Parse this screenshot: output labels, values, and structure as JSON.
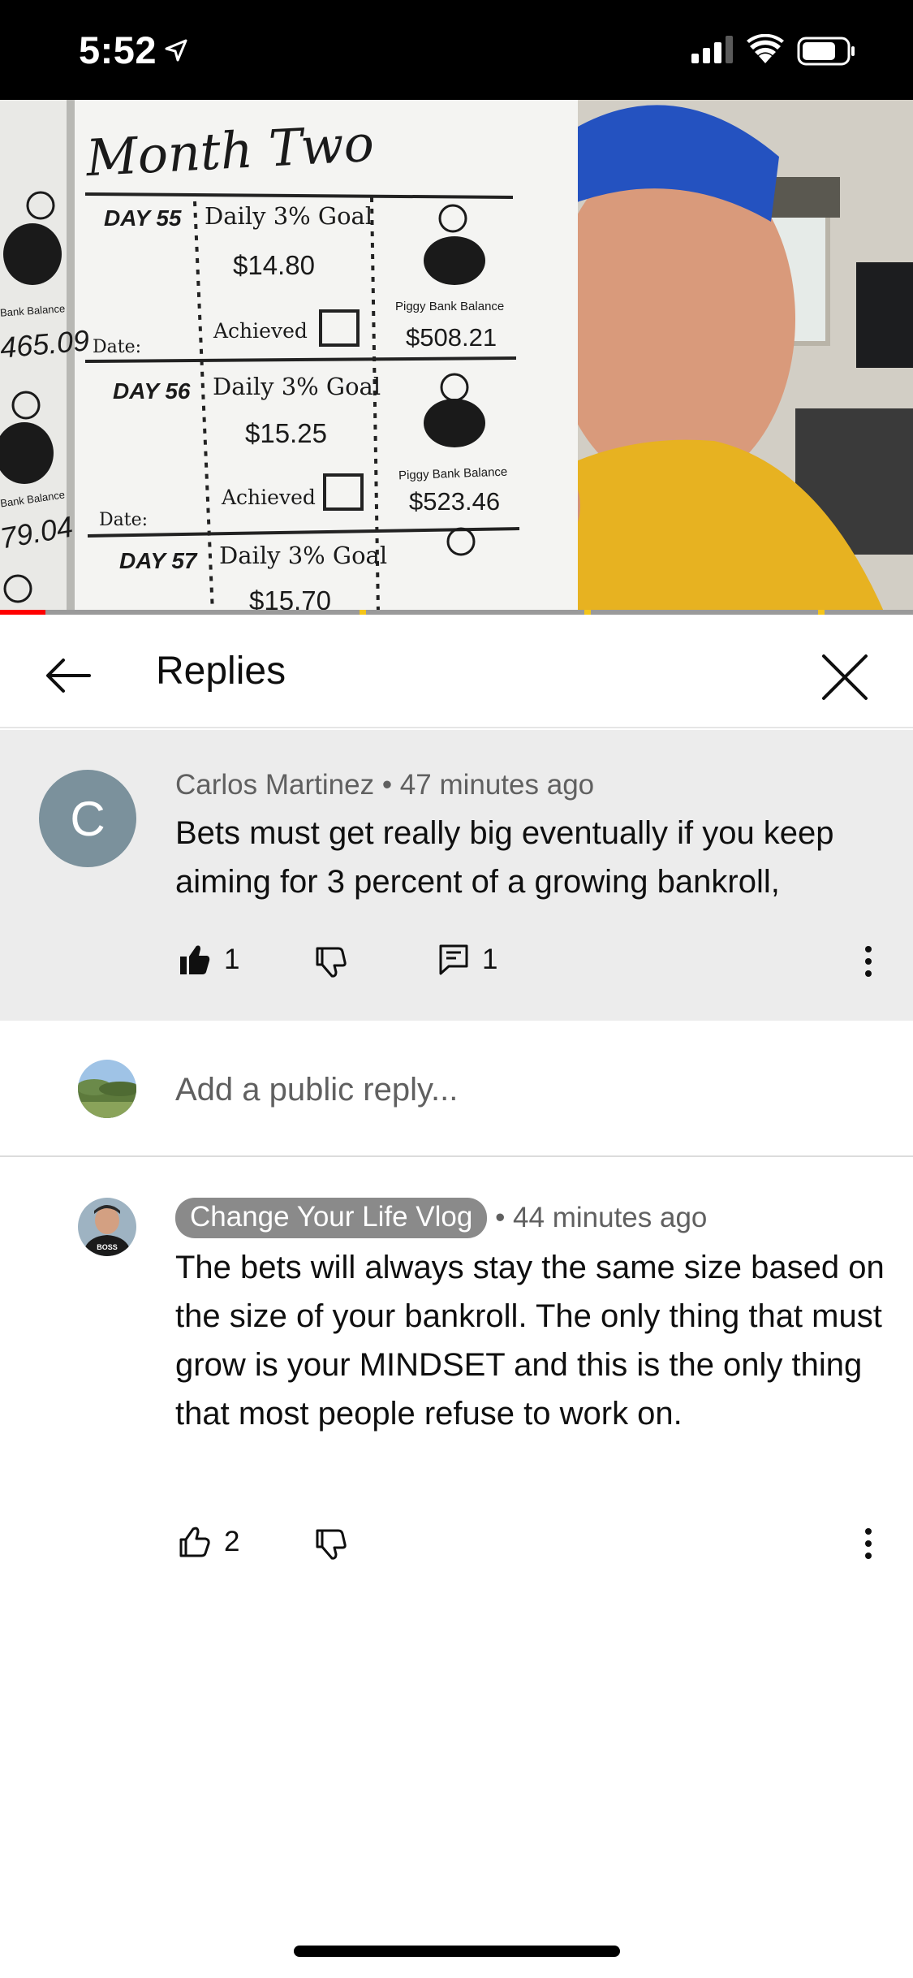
{
  "status_bar": {
    "time": "5:52"
  },
  "video": {
    "page_title": "Month Two",
    "days": [
      {
        "day": "DAY 55",
        "goal_label": "Daily 3% Goal",
        "goal": "$14.80",
        "achieved_label": "Achieved",
        "piggy_label": "Piggy Bank Balance",
        "balance": "$508.21"
      },
      {
        "day": "DAY 56",
        "goal_label": "Daily 3% Goal",
        "goal": "$15.25",
        "achieved_label": "Achieved",
        "piggy_label": "Piggy Bank Balance",
        "balance": "$523.46"
      },
      {
        "day": "DAY 57",
        "goal_label": "Daily 3% Goal",
        "goal": "$15.70"
      }
    ],
    "left_page": {
      "label": "Bank Balance",
      "balance_1": "465.09",
      "balance_2": "79.04",
      "date_label": "Date:"
    },
    "progress": 0.05
  },
  "header": {
    "title": "Replies"
  },
  "parent_comment": {
    "avatar_letter": "C",
    "author": "Carlos Martinez",
    "time": "47 minutes ago",
    "text": "Bets must get really big eventually if you keep aiming for 3 percent of a growing bankroll,",
    "likes": "1",
    "replies": "1"
  },
  "reply_input": {
    "placeholder": "Add a public reply..."
  },
  "reply": {
    "author": "Change Your Life Vlog",
    "time": "44 minutes ago",
    "text": "The bets will always stay the same size based on the size of your bankroll. The only thing that must grow is your MINDSET and this is the only thing that most people refuse to work on.",
    "likes": "2",
    "avatar_text": "BOSS"
  },
  "colors": {
    "accent_red": "#ff0000",
    "avatar_c": "#7b919c",
    "channel_badge": "#8a8a8a",
    "parent_bg": "#ececec"
  }
}
